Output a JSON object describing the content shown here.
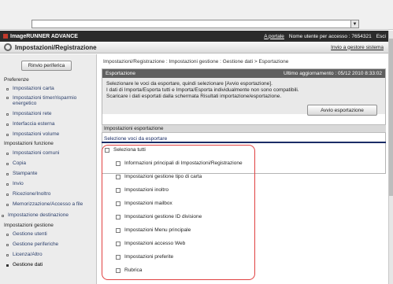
{
  "product": {
    "name": "ImageRUNNER ADVANCE",
    "portal_link": "A portale",
    "user_label": "Nome utente per accesso : 7654321",
    "logout": "Esci"
  },
  "header": {
    "title": "Impostazioni/Registrazione",
    "top_link": "Invio a gestore sistema"
  },
  "sidebar": {
    "button": "Rinvio periferica",
    "sections": [
      {
        "label": "Preferenze"
      },
      {
        "label": "Impostazioni funzione"
      },
      {
        "label": "Impostazione destinazione"
      },
      {
        "label": "Impostazioni gestione"
      }
    ],
    "items": [
      "Impostazioni carta",
      "Impostazioni timer/risparmio energetico",
      "Impostazioni rete",
      "Interfaccia esterna",
      "Impostazioni volume",
      "Impostazioni comuni",
      "Copia",
      "Stampante",
      "Invio",
      "Ricezione/Inoltro",
      "Memorizzazione/Accesso a file",
      "Gestione utenti",
      "Gestione periferiche",
      "Licenza/Altro",
      "Gestione dati"
    ]
  },
  "main": {
    "breadcrumb": "Impostazioni/Registrazione : Impostazioni gestione : Gestione dati > Esportazione",
    "panel_title": "Esportazione",
    "updated": "Ultimo aggiornamento : 05/12 2010 8:33:02",
    "instructions": [
      "Selezionare le voci da esportare, quindi selezionare [Avvio esportazione].",
      "I dati di Importa/Esporta tutti e Importa/Esporta individualmente non sono compatibili.",
      "Scaricare i dati esportati dalla schermata Risultati importazione/esportazione."
    ],
    "export_button": "Avvio esportazione",
    "settings_heading": "Impostazioni esportazione",
    "select_heading": "Selezione voci da esportare",
    "select_all": "Seleziona tutti",
    "options": [
      "Informazioni principali di Impostazioni/Registrazione",
      "Impostazioni gestione tipo di carta",
      "Impostazioni inoltro",
      "Impostazioni mailbox",
      "Impostazioni gestione ID divisione",
      "Impostazioni Menu principale",
      "Impostazioni accesso Web",
      "Impostazioni preferite",
      "Rubrica"
    ]
  }
}
